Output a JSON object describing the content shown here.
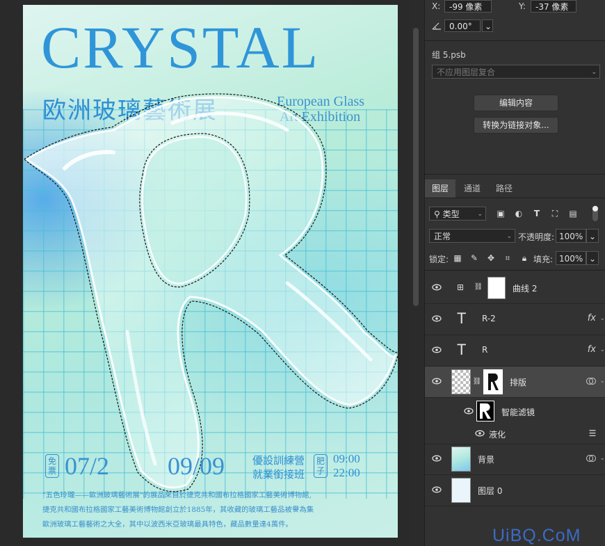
{
  "transform": {
    "x_label": "X:",
    "x_value": "-99 像素",
    "y_label": "Y:",
    "y_value": "-37 像素",
    "angle_value": "0.00°"
  },
  "properties": {
    "group_name": "组 5.psb",
    "comp_select": "不应用图层复合",
    "edit_button": "编辑内容",
    "convert_button": "转换为链接对象..."
  },
  "tabs": [
    "图层",
    "通道",
    "路径"
  ],
  "layers_panel": {
    "filter_select": "类型",
    "blend_mode": "正常",
    "opacity_label": "不透明度:",
    "opacity_value": "100%",
    "lock_label": "锁定:",
    "fill_label": "填充:",
    "fill_value": "100%"
  },
  "layers": [
    {
      "name": "曲线 2"
    },
    {
      "name": "R-2",
      "type_glyph": "T",
      "fx": "fx"
    },
    {
      "name": "R",
      "type_glyph": "T",
      "fx": "fx"
    },
    {
      "name": "排版"
    },
    {
      "name": "智能滤镜"
    },
    {
      "name": "液化"
    },
    {
      "name": "背景"
    },
    {
      "name": "图层 0"
    }
  ],
  "poster": {
    "title": "CRYSTAL",
    "subtitle_cn": "欧洲玻璃藝術展",
    "subtitle_en_1": "European Glass",
    "subtitle_en_2": "Art Exhibition",
    "big_letter": "R",
    "badge_1_a": "免",
    "badge_1_b": "票",
    "date_start": "07/2",
    "date_end": "09/09",
    "course_1": "優設訓練營",
    "course_2": "就業銜接班",
    "badge_2_a": "肥",
    "badge_2_b": "子",
    "time_1": "09:00",
    "time_2": "22:00",
    "desc_1": "\"五色玲瓏——歐洲玻璃藝術展\"的展品來自於捷克共和國布拉格國家工藝美術博物館,",
    "desc_2": "捷克共和國布拉格國家工藝美術博物館創立於1885年，其收藏的玻璃工藝品被譽為集",
    "desc_3": "歐洲玻璃工藝藝術之大全，其中以波西米亞玻璃最具特色，藏品數量達4萬件。"
  },
  "watermark": "UiBQ.CoM"
}
